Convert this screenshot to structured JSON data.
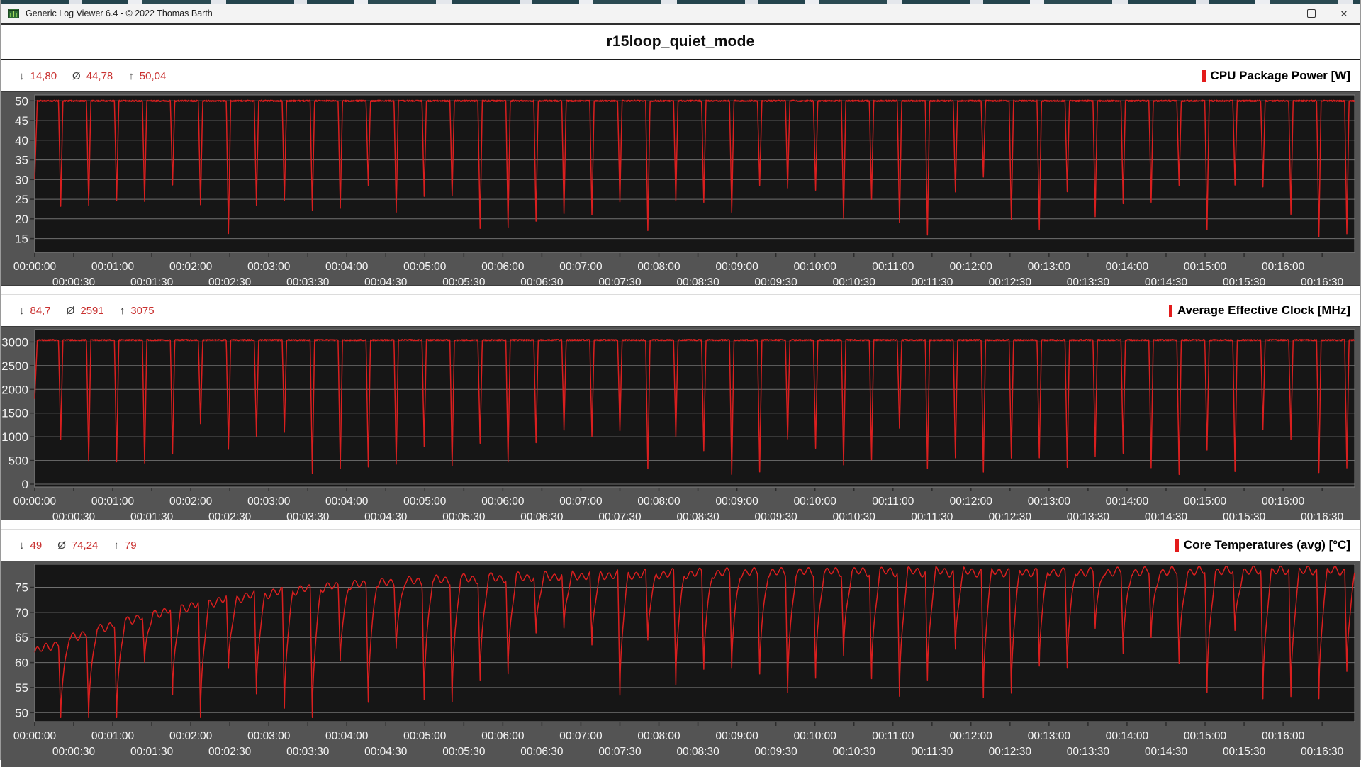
{
  "window": {
    "title": "Generic Log Viewer 6.4 - © 2022 Thomas Barth",
    "controls": {
      "minimize": "–",
      "maximize": "",
      "close": "✕"
    }
  },
  "header": {
    "title": "r15loop_quiet_mode"
  },
  "symbols": {
    "min": "↓",
    "avg": "Ø",
    "max": "↑"
  },
  "colors": {
    "series": "#da1f1f",
    "plot_bg": "#161616",
    "panel_bg": "#545454",
    "grid": "#707070",
    "axis_text": "#f5f5f5",
    "tick": "#2b2b2b",
    "stat_value": "#c9302f",
    "stat_symbol": "#3d3d3d",
    "legend_marker": "#e31b1b",
    "titlebar_bg": "#f3f3f3",
    "content_bg": "#ffffff",
    "section_border": "#1c1c1c"
  },
  "x_axis": {
    "row1": [
      "00:00:00",
      "00:01:00",
      "00:02:00",
      "00:03:00",
      "00:04:00",
      "00:05:00",
      "00:06:00",
      "00:07:00",
      "00:08:00",
      "00:09:00",
      "00:10:00",
      "00:11:00",
      "00:12:00",
      "00:13:00",
      "00:14:00",
      "00:15:00",
      "00:16:00"
    ],
    "row2": [
      "00:00:30",
      "00:01:30",
      "00:02:30",
      "00:03:30",
      "00:04:30",
      "00:05:30",
      "00:06:30",
      "00:07:30",
      "00:08:30",
      "00:09:30",
      "00:10:30",
      "00:11:30",
      "00:12:30",
      "00:13:30",
      "00:14:30",
      "00:15:30",
      "00:16:30"
    ]
  },
  "charts": [
    {
      "legend": "CPU Package Power [W]",
      "stats": {
        "min": "14,80",
        "avg": "44,78",
        "max": "50,04"
      },
      "y_ticks": [
        "50",
        "45",
        "40",
        "35",
        "30",
        "25",
        "20",
        "15"
      ]
    },
    {
      "legend": "Average Effective Clock [MHz]",
      "stats": {
        "min": "84,7",
        "avg": "2591",
        "max": "3075"
      },
      "y_ticks": [
        "3000",
        "2500",
        "2000",
        "1500",
        "1000",
        "500",
        "0"
      ]
    },
    {
      "legend": "Core Temperatures (avg) [°C]",
      "stats": {
        "min": "49",
        "avg": "74,24",
        "max": "79"
      },
      "y_ticks": [
        "75",
        "70",
        "65",
        "60",
        "55",
        "50"
      ]
    }
  ],
  "chart_data": [
    {
      "type": "line",
      "title": "CPU Package Power [W]",
      "ylabel": "W",
      "x_range_s": [
        0,
        1015
      ],
      "x_tick_interval_s": 30,
      "y_tick_values": [
        50,
        45,
        40,
        35,
        30,
        25,
        20,
        15
      ],
      "ylim": [
        11.5,
        51.5
      ],
      "grid": "horizontal",
      "legend_position": "top-right",
      "series": [
        {
          "name": "CPU Package Power [W]",
          "color": "#da1f1f",
          "min": 14.8,
          "avg": 44.78,
          "max": 50.04,
          "description": "Cinebench R15 loop: plateau at ~50 W with one sharp idle dip every ~21.5 s down to 15-31 W; trace starts at ~30 W and ramps to 50 W"
        }
      ],
      "waveform": {
        "kind": "pulse",
        "seed": 11,
        "duration_s": 1015,
        "period_s": 21.5,
        "first_dip_s": 20,
        "ramp_s": 2,
        "start_value": 30,
        "base": 50,
        "base_noise": 0.18,
        "dip_target_min": 15,
        "dip_target_max": 31,
        "dip_half_width_s": 1.7
      }
    },
    {
      "type": "line",
      "title": "Average Effective Clock [MHz]",
      "ylabel": "MHz",
      "x_range_s": [
        0,
        1015
      ],
      "x_tick_interval_s": 30,
      "y_tick_values": [
        3000,
        2500,
        2000,
        1500,
        1000,
        500,
        0
      ],
      "ylim": [
        -60,
        3260
      ],
      "grid": "horizontal",
      "legend_position": "top-right",
      "series": [
        {
          "name": "Average Effective Clock [MHz]",
          "color": "#da1f1f",
          "min": 84.7,
          "avg": 2591,
          "max": 3075,
          "description": "plateau at ~3040 MHz with a sharp dip every ~21.5 s down to ~100-1400 MHz; trace starts at ~1800 MHz"
        }
      ],
      "waveform": {
        "kind": "pulse",
        "seed": 22,
        "duration_s": 1015,
        "period_s": 21.5,
        "first_dip_s": 20,
        "ramp_s": 2,
        "start_value": 1800,
        "base": 3040,
        "base_noise": 14,
        "dip_target_min": 200,
        "dip_target_max": 1400,
        "dip_half_width_s": 1.7
      }
    },
    {
      "type": "line",
      "title": "Core Temperatures (avg) [°C]",
      "ylabel": "°C",
      "x_range_s": [
        0,
        1015
      ],
      "x_tick_interval_s": 30,
      "y_tick_values": [
        75,
        70,
        65,
        60,
        55,
        50
      ],
      "ylim": [
        48.2,
        79.6
      ],
      "grid": "horizontal",
      "legend_position": "top-right",
      "series": [
        {
          "name": "Core Temperatures (avg) [°C]",
          "color": "#da1f1f",
          "min": 49,
          "avg": 74.24,
          "max": 79,
          "description": "warms from ~62 °C to a ~78 °C plateau (tau ~140 s) with a sharp dip every ~21.5 s down to 49-70 °C, recovering over ~6 s"
        }
      ],
      "waveform": {
        "kind": "thermal",
        "seed": 33,
        "duration_s": 1015,
        "period_s": 21.5,
        "first_dip_s": 20,
        "start_value": 62,
        "plateau": 78.2,
        "warmup_tau_s": 140,
        "dip_drop_min": 9,
        "dip_drop_max": 27,
        "floor_value": 49,
        "fall_s": 1.6,
        "recover_s": 6.5,
        "ripple": 0.7
      }
    }
  ]
}
